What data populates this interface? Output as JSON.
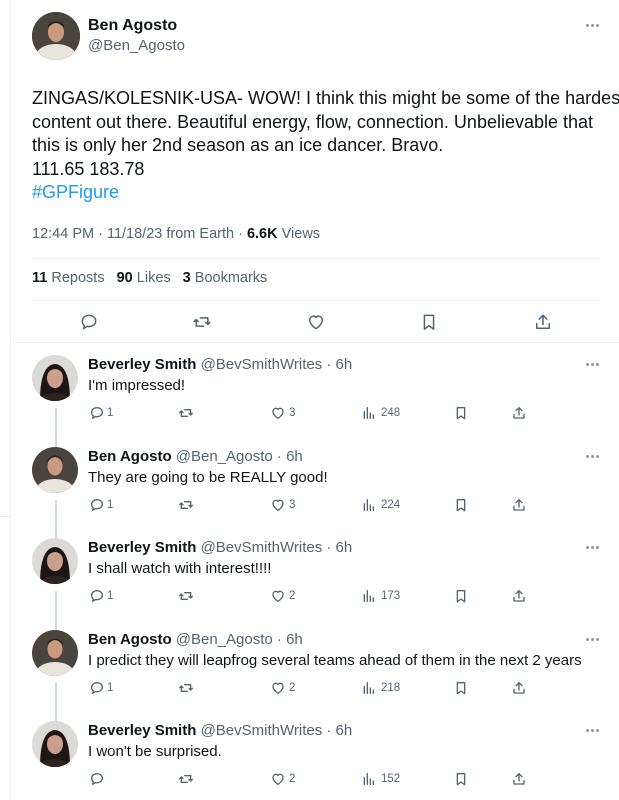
{
  "tweet": {
    "author_name": "Ben Agosto",
    "author_handle": "@Ben_Agosto",
    "text_lines": [
      "ZINGAS/KOLESNIK-USA- WOW! I think this might be some of the hardest",
      "content out there. Beautiful energy, flow, connection. Unbelievable that",
      "this is only her 2nd season as an ice dancer. Bravo.",
      "111.65 183.78"
    ],
    "hashtag": "#GPFigure",
    "time": "12:44 PM",
    "date": "11/18/23",
    "source": "from Earth",
    "views_count": "6.6K",
    "views_label": "Views",
    "reposts_count": "11",
    "reposts_label": "Reposts",
    "likes_count": "90",
    "likes_label": "Likes",
    "bookmarks_count": "3",
    "bookmarks_label": "Bookmarks"
  },
  "replies": [
    {
      "name": "Beverley Smith",
      "handle": "@BevSmithWrites",
      "age": "6h",
      "text": "I'm impressed!",
      "replies": "1",
      "reposts": "",
      "likes": "3",
      "views": "248",
      "avatar": "beverley"
    },
    {
      "name": "Ben Agosto",
      "handle": "@Ben_Agosto",
      "age": "6h",
      "text": "They are going to be REALLY good!",
      "replies": "1",
      "reposts": "",
      "likes": "3",
      "views": "224",
      "avatar": "ben"
    },
    {
      "name": "Beverley Smith",
      "handle": "@BevSmithWrites",
      "age": "6h",
      "text": "I shall watch with interest!!!!",
      "replies": "1",
      "reposts": "",
      "likes": "2",
      "views": "173",
      "avatar": "beverley"
    },
    {
      "name": "Ben Agosto",
      "handle": "@Ben_Agosto",
      "age": "6h",
      "text": "I predict they will leapfrog several teams ahead of them in the next 2 years",
      "replies": "1",
      "reposts": "",
      "likes": "2",
      "views": "218",
      "avatar": "ben"
    },
    {
      "name": "Beverley Smith",
      "handle": "@BevSmithWrites",
      "age": "6h",
      "text": "I won't be surprised.",
      "replies": "",
      "reposts": "",
      "likes": "2",
      "views": "152",
      "avatar": "beverley"
    }
  ],
  "icons": {
    "reply": "speech-bubble-icon",
    "repost": "repost-arrows-icon",
    "like": "heart-icon",
    "bookmark": "bookmark-icon",
    "share": "share-upload-icon",
    "views": "bar-chart-icon",
    "more": "more-dots-icon"
  },
  "colors": {
    "accent": "#1d9bf0",
    "text": "#0f1419",
    "muted": "#536471",
    "divider": "#eff3f4"
  }
}
